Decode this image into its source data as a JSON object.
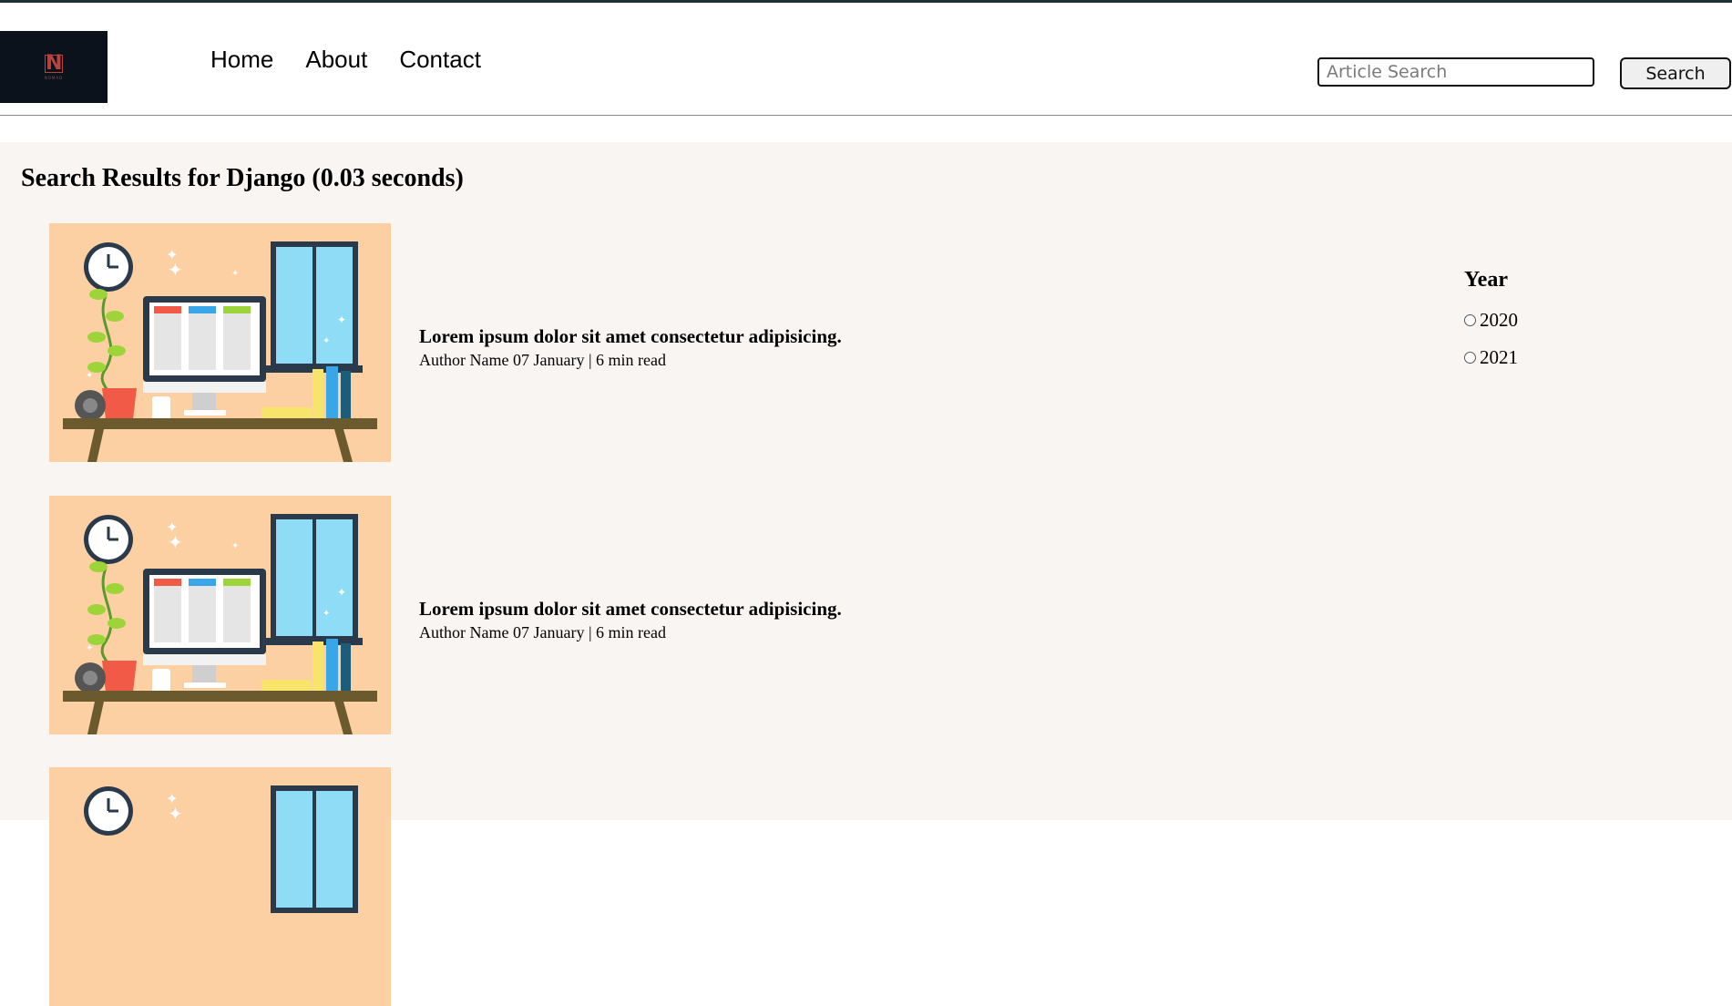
{
  "header": {
    "logo_text": "NOMAD",
    "logo_mark": "N",
    "nav": [
      "Home",
      "About",
      "Contact"
    ],
    "search_placeholder": "Article Search",
    "search_button": "Search"
  },
  "main": {
    "results_heading": "Search Results for Django (0.03 seconds)",
    "results": [
      {
        "title": "Lorem ipsum dolor sit amet consectetur adipisicing.",
        "meta": "Author Name 07 January | 6 min read"
      },
      {
        "title": "Lorem ipsum dolor sit amet consectetur adipisicing.",
        "meta": "Author Name 07 January | 6 min read"
      },
      {
        "title": "",
        "meta": ""
      }
    ],
    "filter": {
      "title": "Year",
      "options": [
        "2020",
        "2021"
      ]
    }
  },
  "colors": {
    "logo_bg": "#0c121c",
    "logo_accent": "#b8423c",
    "page_bg": "#f9f5f3",
    "thumb_bg": "#fdd0a3"
  },
  "icons": [
    "logo-icon",
    "desk-illustration"
  ]
}
